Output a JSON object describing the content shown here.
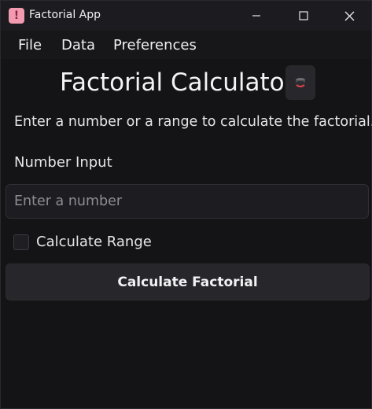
{
  "window": {
    "title": "Factorial App",
    "app_icon_glyph": "!",
    "icon_names": {
      "app": "app-icon",
      "minimize": "minimize-icon",
      "maximize": "maximize-icon",
      "close": "close-icon",
      "theme": "theme-toggle-icon"
    }
  },
  "menu": {
    "items": [
      "File",
      "Data",
      "Preferences"
    ]
  },
  "main": {
    "heading": "Factorial Calculator",
    "subtitle": "Enter a number or a range to calculate the factorial.",
    "input_label": "Number Input",
    "input_placeholder": "Enter a number",
    "input_value": "",
    "checkbox_label": "Calculate Range",
    "checkbox_checked": false,
    "button_label": "Calculate Factorial"
  },
  "colors": {
    "background": "#141416",
    "titlebar": "#1c1c20",
    "app_icon": "#f29bb0",
    "button": "#26262b",
    "theme_accent": "#e0424b"
  }
}
